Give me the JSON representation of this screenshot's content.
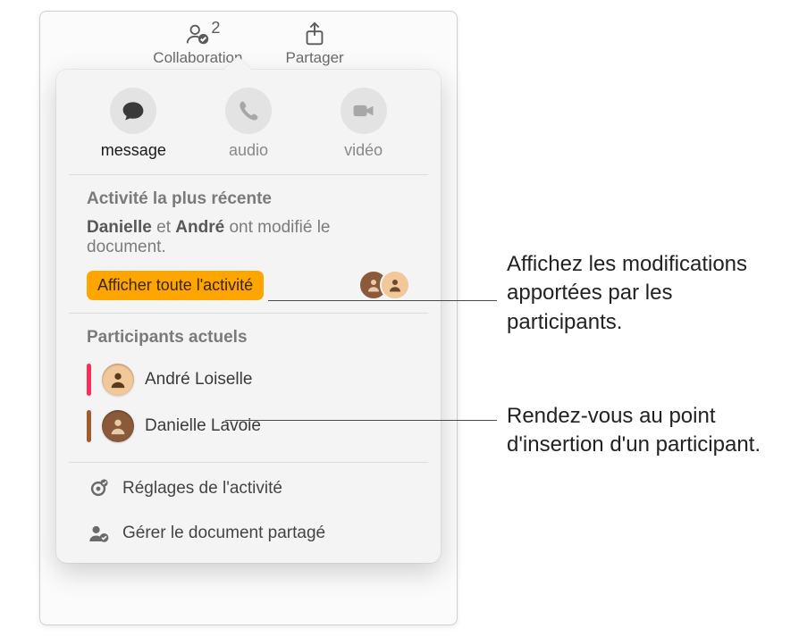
{
  "toolbar": {
    "collaboration": {
      "label": "Collaboration",
      "count": "2"
    },
    "share": {
      "label": "Partager"
    }
  },
  "popover": {
    "contact_row": {
      "message": "message",
      "audio": "audio",
      "video": "vidéo"
    },
    "recent_activity": {
      "title": "Activité la plus récente",
      "summary_parts": {
        "name1": "Danielle",
        "connector1": "et",
        "name2": "André",
        "rest": "ont modifié le document."
      },
      "show_all_button": "Afficher toute l'activité"
    },
    "participants": {
      "title": "Participants actuels",
      "list": [
        {
          "name": "André Loiselle",
          "color": "#ff2d55",
          "avatar_bg": "#f2c79a"
        },
        {
          "name": "Danielle Lavoie",
          "color": "#a45a2a",
          "avatar_bg": "#8a5a3a"
        }
      ]
    },
    "actions": {
      "activity_settings": "Réglages de l'activité",
      "manage_shared": "Gérer le document partagé"
    }
  },
  "callouts": {
    "activity": "Affichez les modifications apportées par les participants.",
    "participant": "Rendez-vous au point d'insertion d'un participant."
  }
}
